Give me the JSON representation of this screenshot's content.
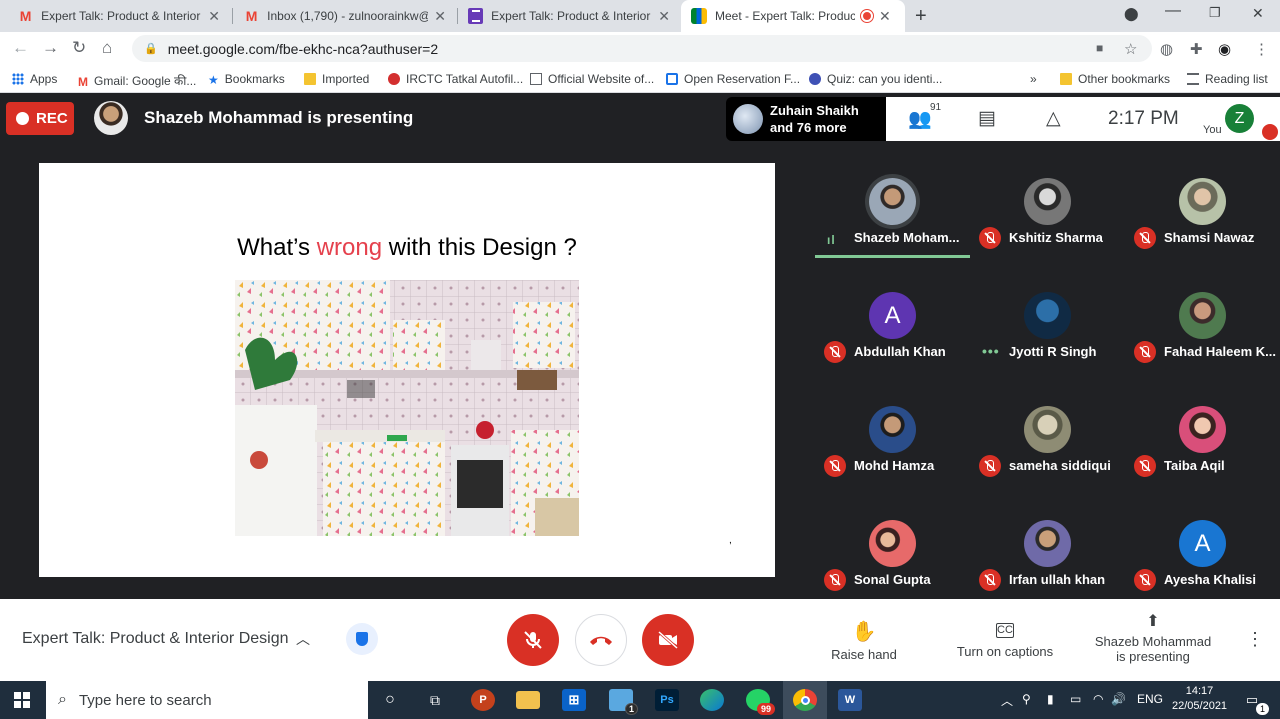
{
  "browser": {
    "tabs": [
      {
        "title": "Expert Talk: Product & Interior De",
        "icon": "gmail-icon"
      },
      {
        "title": "Inbox (1,790) - zulnoorainkw@iul",
        "icon": "gmail-icon"
      },
      {
        "title": "Expert Talk: Product & Interior De",
        "icon": "forms-icon"
      },
      {
        "title": "Meet - Expert Talk: Product &",
        "icon": "meet-icon"
      }
    ],
    "url": "meet.google.com/fbe-ekhc-nca?authuser=2",
    "bookmarks": [
      {
        "label": "Apps"
      },
      {
        "label": "Gmail: Google की..."
      },
      {
        "label": "Bookmarks"
      },
      {
        "label": "Imported"
      },
      {
        "label": "IRCTC Tatkal Autofil..."
      },
      {
        "label": "Official Website of..."
      },
      {
        "label": "Open Reservation F..."
      },
      {
        "label": "Quiz: can you identi..."
      }
    ],
    "overflow": "»",
    "other_bookmarks": "Other bookmarks",
    "reading_list": "Reading list"
  },
  "meet_top": {
    "rec_label": "REC",
    "presenting_title": "Shazeb Mohammad is presenting",
    "joined_line1": "Zuhain Shaikh",
    "joined_line2": "and 76 more",
    "participant_count": "91",
    "time": "2:17 PM",
    "you_label": "You",
    "you_initial": "Z"
  },
  "slide": {
    "title_before": "What’s ",
    "title_highlight": "wrong",
    "title_after": " with this Design ?",
    "comma": ","
  },
  "participants": [
    {
      "name": "Shazeb Moham...",
      "status": "speaking"
    },
    {
      "name": "Kshitiz Sharma",
      "status": "muted"
    },
    {
      "name": "Shamsi Nawaz",
      "status": "muted"
    },
    {
      "name": "Abdullah Khan",
      "status": "muted",
      "initial": "A"
    },
    {
      "name": "Jyotti R Singh",
      "status": "idle"
    },
    {
      "name": "Fahad Haleem K...",
      "status": "muted"
    },
    {
      "name": "Mohd Hamza",
      "status": "muted"
    },
    {
      "name": "sameha siddiqui",
      "status": "muted"
    },
    {
      "name": "Taiba Aqil",
      "status": "muted"
    },
    {
      "name": "Sonal Gupta",
      "status": "muted"
    },
    {
      "name": "Irfan ullah khan",
      "status": "muted"
    },
    {
      "name": "Ayesha Khalisi",
      "status": "muted",
      "initial": "A"
    }
  ],
  "meet_bottom": {
    "meeting_name": "Expert Talk: Product & Interior Design",
    "raise_hand": "Raise hand",
    "captions": "Turn on captions",
    "presenting_line1": "Shazeb Mohammad",
    "presenting_line2": "is presenting"
  },
  "taskbar": {
    "search_placeholder": "Type here to search",
    "lang": "ENG",
    "time": "14:17",
    "date": "22/05/2021",
    "notification_count": "1",
    "whatsapp_badge": "99",
    "notepad_badge": "1"
  },
  "colors": {
    "rec_red": "#d93025",
    "accent_green": "#81c995",
    "slide_highlight": "#e5414d",
    "avatar_purple": "#5e35b1",
    "avatar_blue": "#1976d2"
  }
}
